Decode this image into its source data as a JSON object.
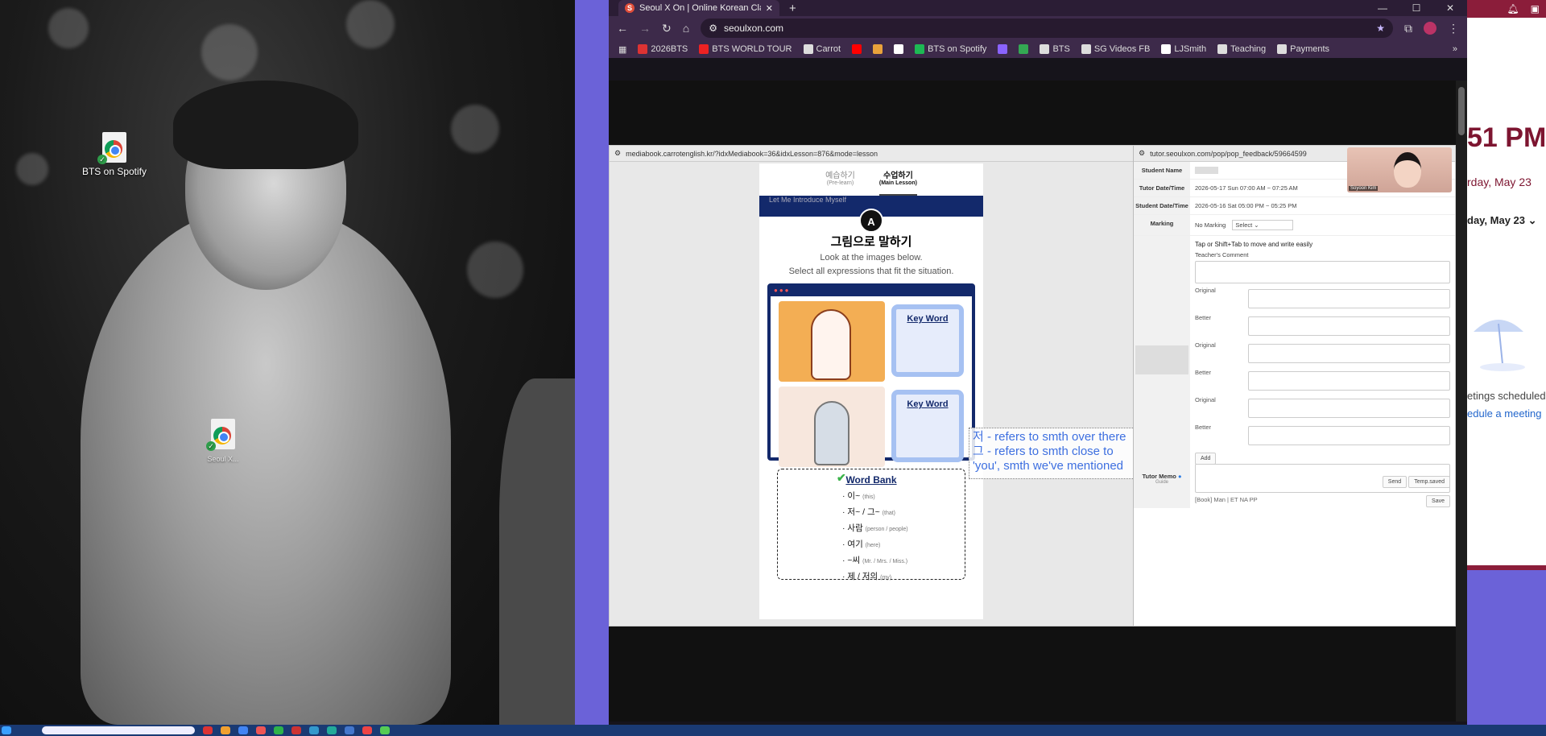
{
  "desktop": {
    "icons": [
      {
        "label": "BTS on Spotify"
      },
      {
        "label": "Seoul X..."
      }
    ]
  },
  "browser": {
    "tab": {
      "title": "Seoul X On | Online Korean Cla",
      "favicon": "S"
    },
    "address": "seoulxon.com",
    "bookmarks": [
      {
        "label": "2026BTS",
        "icon": "bookmark-image-icon",
        "color": "#d33"
      },
      {
        "label": "BTS WORLD TOUR",
        "icon": "bookmark-dots-icon",
        "color": "#e22"
      },
      {
        "label": "Carrot",
        "icon": "folder-icon",
        "color": "#ddd"
      },
      {
        "label": "",
        "icon": "youtube-icon",
        "color": "#f00"
      },
      {
        "label": "",
        "icon": "drive-triangle-icon",
        "color": "#e9a23b"
      },
      {
        "label": "",
        "icon": "x-icon",
        "color": "#fff"
      },
      {
        "label": "BTS on Spotify",
        "icon": "spotify-icon",
        "color": "#1db954"
      },
      {
        "label": "",
        "icon": "mail-icon",
        "color": "#8a63ff"
      },
      {
        "label": "",
        "icon": "drive-icon",
        "color": "#34a853"
      },
      {
        "label": "BTS",
        "icon": "folder-icon",
        "color": "#ddd"
      },
      {
        "label": "SG Videos FB",
        "icon": "folder-icon",
        "color": "#ddd"
      },
      {
        "label": "LJSmith",
        "icon": "bookmark-page-icon",
        "color": "#fff"
      },
      {
        "label": "Teaching",
        "icon": "folder-icon",
        "color": "#ddd"
      },
      {
        "label": "Payments",
        "icon": "folder-icon",
        "color": "#ddd"
      }
    ]
  },
  "lesson": {
    "url": "mediabook.carrotenglish.kr/?idxMediabook=36&idxLesson=876&mode=lesson",
    "tab_prelearn": "예습하기",
    "tab_prelearn_sub": "(Pre-learn)",
    "tab_main": "수업하기",
    "tab_main_sub": "(Main Lesson)",
    "band_text": "Let Me Introduce Myself",
    "badge": "A",
    "title": "그림으로 말하기",
    "instruction_1": "Look at the images below.",
    "instruction_2": "Select all expressions that fit the situation.",
    "keyword_1": "Key Word",
    "keyword_2": "Key Word",
    "wordbank_title": "Word Bank",
    "wordbank": [
      {
        "word": "· 이~",
        "gloss": "(this)"
      },
      {
        "word": "· 저~ / 그~",
        "gloss": "(that)"
      },
      {
        "word": "· 사람",
        "gloss": "(person / people)"
      },
      {
        "word": "· 여기",
        "gloss": "(here)"
      },
      {
        "word": "· ~씨",
        "gloss": "(Mr. / Mrs. / Miss.)"
      },
      {
        "word": "· 제 / 저의",
        "gloss": "(my)"
      }
    ]
  },
  "annotation": {
    "line1": "저 - refers to smth over there",
    "line2": "그 - refers to smth close to",
    "line3": "'you', smth we've mentioned"
  },
  "feedback": {
    "url": "tutor.seoulxon.com/pop/pop_feedback/59664599",
    "student_name_label": "Student Name",
    "tutor_dt_label": "Tutor Date/Time",
    "tutor_dt": "2026-05-17 Sun 07:00 AM ~ 07:25 AM",
    "student_dt_label": "Student Date/Time",
    "student_dt": "2026-05-16 Sat 05:00 PM ~ 05:25 PM",
    "marking_label": "Marking",
    "marking_value": "No Marking",
    "marking_select": "Select",
    "hint": "Tap or Shift+Tab to move and write easily",
    "teacher_comment": "Teacher's Comment",
    "original": "Original",
    "better": "Better",
    "add": "Add",
    "send": "Send",
    "temp_saved": "Temp.saved",
    "memo_tags": "[Book]  Man  |  ET  NA  PP",
    "tutor_memo_label": "Tutor Memo",
    "guide": "Guide",
    "save": "Save",
    "video_name": "Soyoon Kim"
  },
  "calendar": {
    "time": "51 PM",
    "date": "rday, May 23",
    "day": "day, May 23",
    "none": "etings scheduled.",
    "link": "edule a meeting"
  }
}
